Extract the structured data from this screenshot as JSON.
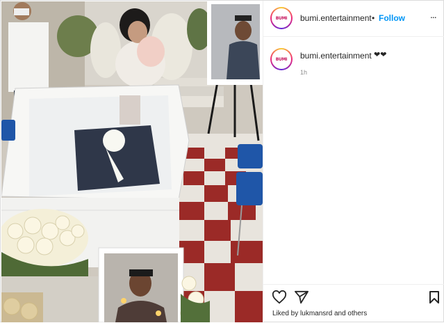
{
  "post": {
    "username": "bumi.entertainment",
    "separator": "•",
    "follow_label": "Follow",
    "more_label": "...",
    "avatar_text": "BUMI",
    "caption_text": "❤❤",
    "time_ago": "1h",
    "liked_by_prefix": "Liked by",
    "liked_by_user": "lukmansrd",
    "liked_by_suffix": "and others"
  },
  "icons": {
    "like": "heart-outline-icon",
    "share": "paper-plane-icon",
    "save": "bookmark-icon",
    "more": "more-options-icon"
  },
  "colors": {
    "follow_blue": "#0095f6",
    "meta_gray": "#8e8e8e",
    "border": "#dbdbdb"
  }
}
